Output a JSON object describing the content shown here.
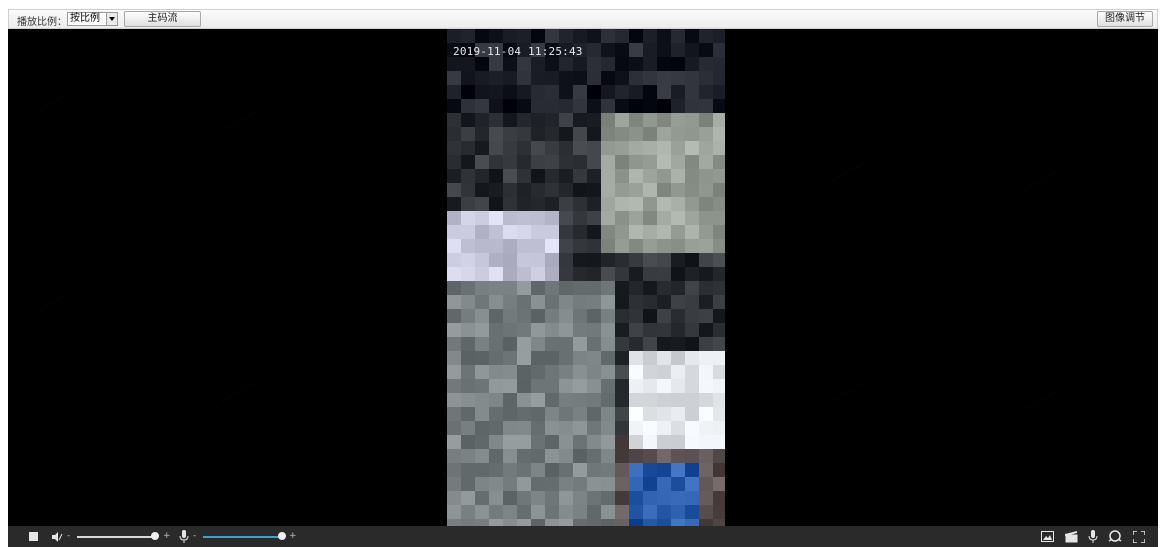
{
  "toolbar": {
    "ratio_label": "播放比例：",
    "ratio_value": "按比例",
    "stream_button": "主码流",
    "image_button": "图像调节"
  },
  "video": {
    "timestamp": "2019-11-04 11:25:43"
  },
  "controls": {
    "volume_level": 1.0,
    "mic_level": 1.0,
    "icons": [
      "stop-icon",
      "speaker-icon",
      "mic-icon",
      "snapshot-icon",
      "record-icon",
      "talk-icon",
      "zoom-icon",
      "fullscreen-icon"
    ]
  },
  "colors": {
    "video_bg": "#000000",
    "control_bar": "#2a2a2a",
    "slider_accent": "#3aa0d8"
  }
}
